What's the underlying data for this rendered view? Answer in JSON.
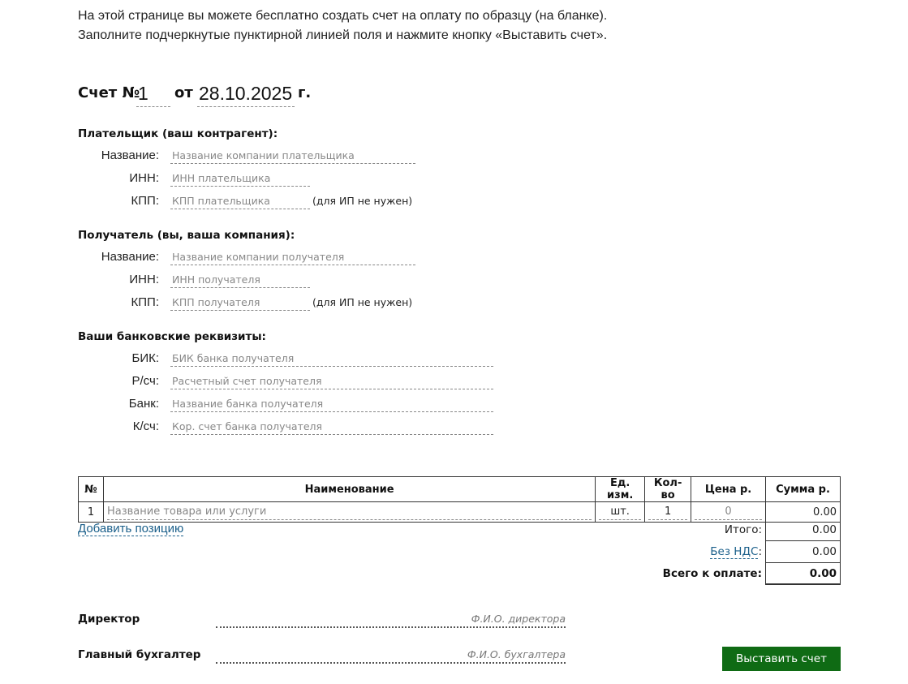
{
  "intro": {
    "line1": "На этой странице вы можете бесплатно создать счет на оплату по образцу (на бланке).",
    "line2": "Заполните подчеркнутые пунктирной линией поля и нажмите кнопку «Выставить счет»."
  },
  "invoice": {
    "title_label": "Счет №",
    "number": "1",
    "from_label": "от",
    "date": "28.10.2025",
    "year_suffix": "г."
  },
  "payer": {
    "heading": "Плательщик (ваш контрагент):",
    "name_label": "Название:",
    "name_placeholder": "Название компании плательщика",
    "inn_label": "ИНН:",
    "inn_placeholder": "ИНН плательщика",
    "kpp_label": "КПП:",
    "kpp_placeholder": "КПП плательщика",
    "kpp_note": "(для ИП не нужен)"
  },
  "recipient": {
    "heading": "Получатель (вы, ваша компания):",
    "name_label": "Название:",
    "name_placeholder": "Название компании получателя",
    "inn_label": "ИНН:",
    "inn_placeholder": "ИНН получателя",
    "kpp_label": "КПП:",
    "kpp_placeholder": "КПП получателя",
    "kpp_note": "(для ИП не нужен)"
  },
  "bank": {
    "heading": "Ваши банковские реквизиты:",
    "bik_label": "БИК:",
    "bik_placeholder": "БИК банка получателя",
    "rs_label": "Р/сч:",
    "rs_placeholder": "Расчетный счет получателя",
    "bank_label": "Банк:",
    "bank_placeholder": "Название банка получателя",
    "ks_label": "К/сч:",
    "ks_placeholder": "Кор. счет банка получателя"
  },
  "table": {
    "headers": [
      "№",
      "Наименование",
      "Ед. изм.",
      "Кол-во",
      "Цена р.",
      "Сумма р."
    ],
    "rows": [
      {
        "num": "1",
        "name_placeholder": "Название товара или услуги",
        "unit": "шт.",
        "qty": "1",
        "price_placeholder": "0",
        "sum": "0.00"
      }
    ]
  },
  "add_position": "Добавить позицию",
  "totals": {
    "itogo_label": "Итого:",
    "itogo_value": "0.00",
    "nds_label": "Без НДС",
    "nds_colon": ":",
    "nds_value": "0.00",
    "total_label": "Всего к оплате:",
    "total_value": "0.00"
  },
  "signatures": {
    "director_label": "Директор",
    "director_placeholder": "Ф.И.О. директора",
    "accountant_label": "Главный бухгалтер",
    "accountant_placeholder": "Ф.И.О. бухгалтера"
  },
  "submit_label": "Выставить счет",
  "colors": {
    "accent": "#0f6b14",
    "link": "#1a5f8a"
  }
}
